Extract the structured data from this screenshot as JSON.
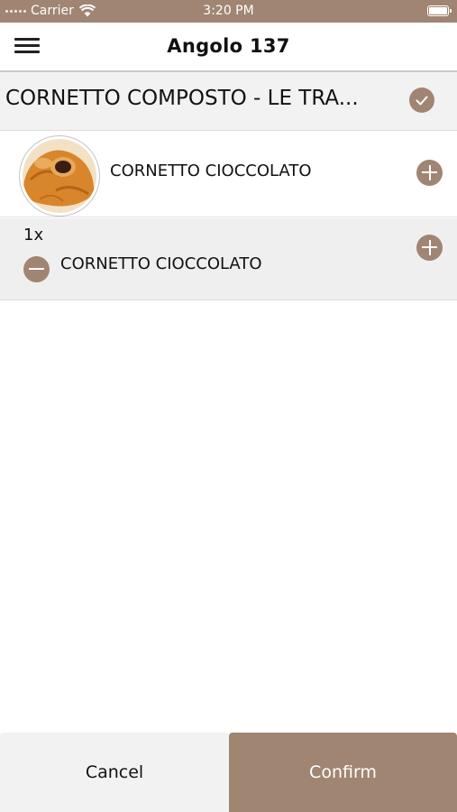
{
  "status_bar": {
    "carrier": "Carrier",
    "time": "3:20 PM"
  },
  "nav": {
    "title": "Angolo 137",
    "menu_icon": "hamburger-menu-icon"
  },
  "product": {
    "title": "CORNETTO COMPOSTO - LE TRA...",
    "status_icon": "checkmark-icon"
  },
  "options": [
    {
      "label": "CORNETTO CIOCCOLATO",
      "image": "croissant-chocolate-image",
      "action_icon": "plus-circle-icon"
    }
  ],
  "selected": [
    {
      "quantity": "1x",
      "label": "CORNETTO CIOCCOLATO",
      "add_icon": "plus-circle-icon",
      "remove_icon": "minus-circle-icon"
    }
  ],
  "actions": {
    "cancel_label": "Cancel",
    "confirm_label": "Confirm"
  },
  "colors": {
    "accent": "#a08572",
    "header_background": "#f2f2f2",
    "selected_background": "#efefef"
  }
}
